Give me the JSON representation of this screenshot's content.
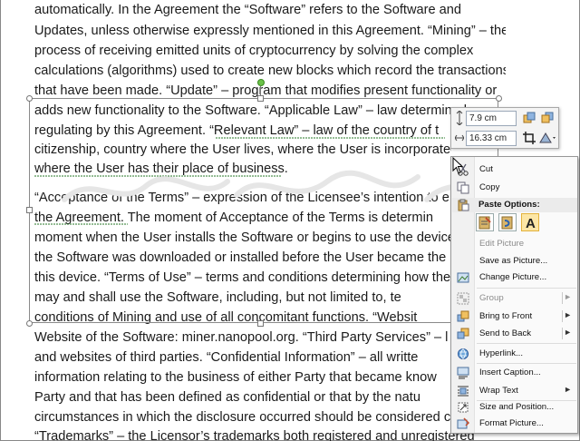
{
  "document": {
    "lines": [
      "automatically. In the Agreement the “Software” refers to the Software and",
      "Updates, unless otherwise expressly mentioned in this Agreement. “Mining” – the",
      "process of receiving emitted units of cryptocurrency by solving the complex",
      "calculations (algorithms) used to create new blocks which record the transactions",
      "that have been made. “Update” – program that modifies present functionality or",
      "adds new functionality to the Software. “Applicable Law” – law determined as",
      "regulating by this Agreement. “Relevant Law” – law of the country of t",
      "citizenship, country where the User lives, where the User is incorporated or",
      "where the User has their place of business.",
      "“Acceptance of the Terms” – expression of the Licensee’s intention to e",
      "the Agreement. The moment of Acceptance of the Terms is determin",
      "moment when the User installs the Software or begins to use the device",
      "the Software was downloaded or installed before the User became the",
      "this device. “Terms of Use” – terms and conditions determining how the",
      "may and shall use the Software, including, but not limited to, te",
      "conditions of Mining and use of all concomitant functions. “Websit",
      "Website of the Software: miner.nanopool.org. “Third Party Services” – l",
      "and websites of third parties. “Confidential Information” – all writte",
      "information relating to the business of either Party that became know",
      "Party and that has been defined as confidential or that by the natu",
      "circumstances in which the disclosure occurred should be considered con",
      "“Trademarks” – the Licensor’s trademarks both registered and unregistered"
    ]
  },
  "mini_toolbar": {
    "height_value": "7.9 cm",
    "width_value": "16.33 cm",
    "icons": [
      "shape-height-icon",
      "bring-forward-icon",
      "send-backward-icon",
      "shape-width-icon",
      "crop-icon",
      "shape-styles-icon"
    ]
  },
  "context_menu": {
    "cut": "Cut",
    "copy": "Copy",
    "paste_options": "Paste Options:",
    "edit_picture": "Edit Picture",
    "save_as_picture": "Save as Picture...",
    "change_picture": "Change Picture...",
    "group": "Group",
    "bring_to_front": "Bring to Front",
    "send_to_back": "Send to Back",
    "hyperlink": "Hyperlink...",
    "insert_caption": "Insert Caption...",
    "wrap_text": "Wrap Text",
    "size_and_position": "Size and Position...",
    "format_picture": "Format Picture...",
    "submenu_arrow": "►"
  },
  "colors": {
    "accent_hover": "#fad67a",
    "rotate_handle": "#6cc24a",
    "text": "#1a1a1a"
  }
}
